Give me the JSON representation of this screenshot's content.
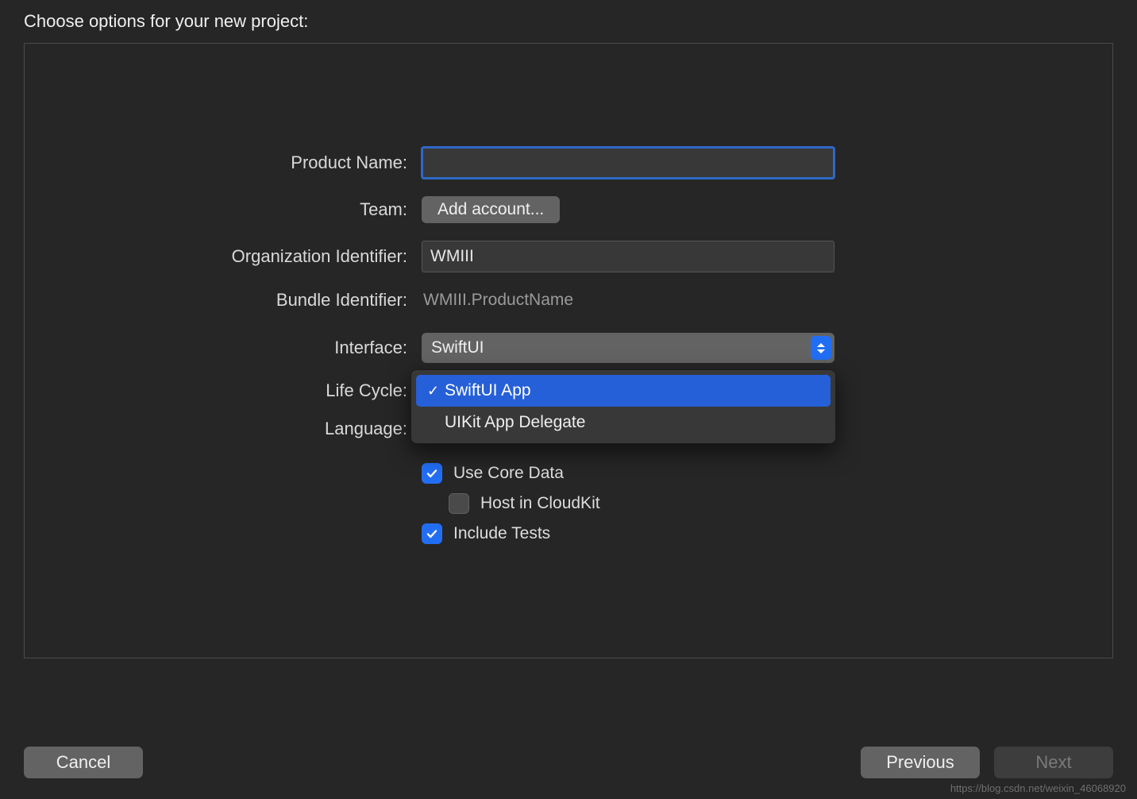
{
  "dialog": {
    "title": "Choose options for your new project:"
  },
  "form": {
    "product_name": {
      "label": "Product Name:",
      "value": ""
    },
    "team": {
      "label": "Team:",
      "button": "Add account..."
    },
    "org_id": {
      "label": "Organization Identifier:",
      "value": "WMIII"
    },
    "bundle_id": {
      "label": "Bundle Identifier:",
      "value": "WMIII.ProductName"
    },
    "interface": {
      "label": "Interface:",
      "value": "SwiftUI"
    },
    "life_cycle": {
      "label": "Life Cycle:",
      "options": [
        "SwiftUI App",
        "UIKit App Delegate"
      ],
      "selected_index": 0
    },
    "language": {
      "label": "Language:"
    },
    "use_core_data": {
      "label": "Use Core Data",
      "checked": true
    },
    "host_cloudkit": {
      "label": "Host in CloudKit",
      "checked": false
    },
    "include_tests": {
      "label": "Include Tests",
      "checked": true
    }
  },
  "footer": {
    "cancel": "Cancel",
    "previous": "Previous",
    "next": "Next"
  },
  "watermark": "https://blog.csdn.net/weixin_46068920"
}
